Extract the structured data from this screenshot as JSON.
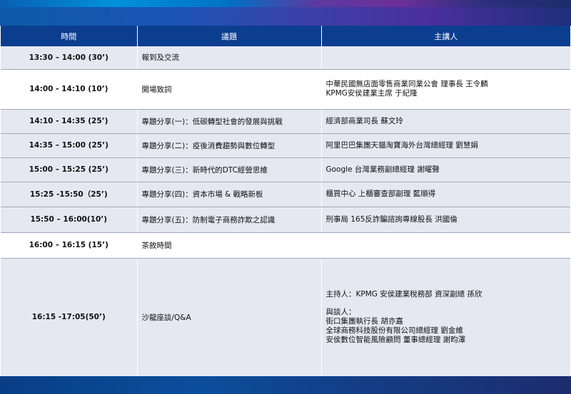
{
  "header": {
    "time": "時間",
    "topic": "議題",
    "speaker": "主講人"
  },
  "rows": [
    {
      "time": "13:30 – 14:00 (30’)",
      "topic": "報到及交流",
      "speaker": []
    },
    {
      "time": "14:00 - 14:10 (10’)",
      "topic": "開場致詞",
      "speaker": [
        "中華民國無店面零售商業同業公會 理事長 王令麟",
        "KPMG安侯建業主席 于紀隆"
      ]
    },
    {
      "time": "14:10 - 14:35 (25’)",
      "topic": "專題分享(一)：低碳轉型社會的發展與挑戰",
      "speaker": [
        "經濟部商業司長 蘇文玲"
      ]
    },
    {
      "time": "14:35 – 15:00 (25’)",
      "topic": "專題分享(二)：疫後消費趨勢與數位轉型",
      "speaker": [
        "阿里巴巴集團天貓淘寶海外台灣總經理 劉慧娟"
      ]
    },
    {
      "time": "15:00 – 15:25 (25’)",
      "topic": "專題分享(三)：新時代的DTC經營思維",
      "speaker": [
        "Google 台灣業務副總經理 謝曜聲"
      ]
    },
    {
      "time": "15:25 -15:50（25’)",
      "topic": "專題分享(四)：資本市場 & 戰略新板",
      "speaker": [
        "櫃買中心 上櫃審查部副理 藍順得"
      ]
    },
    {
      "time": "15:50 – 16:00(10’)",
      "topic": "專題分享(五)：防制電子商務詐欺之認識",
      "speaker": [
        "刑事局 165反詐騙諮詢專線股長 洪國倫"
      ]
    },
    {
      "time": "16:00 – 16:15 (15’)",
      "topic": "茶敘時間",
      "speaker": []
    },
    {
      "time": "16:15 -17:05(50’)",
      "topic": "沙龍座談/Q&A",
      "speaker": [
        "主持人：KPMG 安侯建業稅務部 資深副總 孫欣",
        "",
        "與談人：",
        "街口集團執行長 胡亦嘉",
        "全球商務科技股份有限公司總經理 劉金維",
        "安侯數位智能風險顧問 董事總經理 謝昀澤"
      ]
    }
  ]
}
